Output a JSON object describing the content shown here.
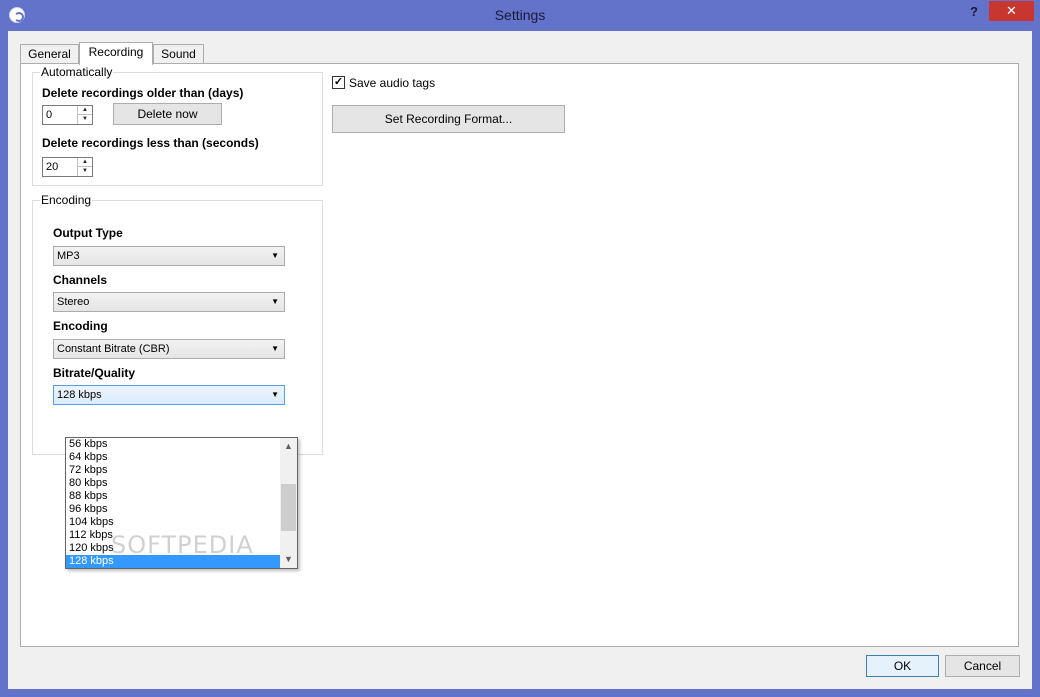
{
  "window": {
    "title": "Settings",
    "help": "?",
    "close": "✕"
  },
  "tabs": [
    {
      "label": "General"
    },
    {
      "label": "Recording"
    },
    {
      "label": "Sound"
    }
  ],
  "automatically": {
    "legend": "Automatically",
    "older_label": "Delete recordings older than (days)",
    "older_value": "0",
    "delete_now": "Delete now",
    "less_label": "Delete recordings less than (seconds)",
    "less_value": "20"
  },
  "encoding": {
    "legend": "Encoding",
    "output_type_label": "Output Type",
    "output_type_value": "MP3",
    "channels_label": "Channels",
    "channels_value": "Stereo",
    "encoding_label": "Encoding",
    "encoding_value": "Constant Bitrate (CBR)",
    "bitrate_label": "Bitrate/Quality",
    "bitrate_value": "128 kbps",
    "bitrate_options": [
      "56 kbps",
      "64 kbps",
      "72 kbps",
      "80 kbps",
      "88 kbps",
      "96 kbps",
      "104 kbps",
      "112 kbps",
      "120 kbps",
      "128 kbps"
    ]
  },
  "right": {
    "save_tags_label": "Save audio tags",
    "save_tags_checked": true,
    "set_format": "Set Recording Format..."
  },
  "footer": {
    "ok": "OK",
    "cancel": "Cancel"
  },
  "watermark": "SOFTPEDIA",
  "colors": {
    "accent": "#3399ff",
    "titlebar": "#6273c9",
    "close": "#c7372f"
  }
}
